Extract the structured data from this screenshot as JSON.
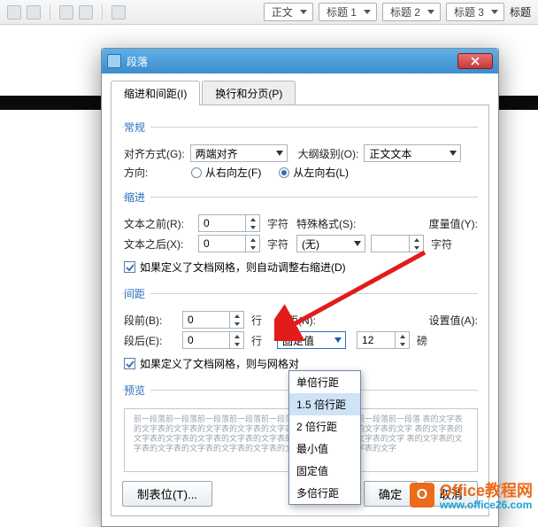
{
  "ribbon": {
    "style_main": "正文",
    "style_presets": [
      "标题 1",
      "标题 2",
      "标题 3",
      "标题"
    ]
  },
  "dialog": {
    "title": "段落",
    "tabs": {
      "indent": "缩进和间距(I)",
      "page": "换行和分页(P)"
    },
    "general": {
      "legend": "常规",
      "align_label": "对齐方式(G):",
      "align_value": "两端对齐",
      "outline_label": "大纲级别(O):",
      "outline_value": "正文文本",
      "direction_label": "方向:",
      "rtl_label": "从右向左(F)",
      "ltr_label": "从左向右(L)"
    },
    "indent": {
      "legend": "缩进",
      "before_label": "文本之前(R):",
      "before_value": "0",
      "after_label": "文本之后(X):",
      "after_value": "0",
      "unit_char": "字符",
      "special_label": "特殊格式(S):",
      "special_value": "(无)",
      "measure_label": "度量值(Y):",
      "measure_value": "",
      "grid_cb": "如果定义了文档网格，则自动调整右缩进(D)"
    },
    "spacing": {
      "legend": "间距",
      "before_label": "段前(B):",
      "before_value": "0",
      "after_label": "段后(E):",
      "after_value": "0",
      "unit_line": "行",
      "linespacing_label": "行距(N):",
      "linespacing_value": "固定值",
      "at_label": "设置值(A):",
      "at_value": "12",
      "at_unit": "磅",
      "grid_cb": "如果定义了文档网格，则与网格对",
      "options": [
        "单倍行距",
        "1.5 倍行距",
        "2 倍行距",
        "最小值",
        "固定值",
        "多倍行距"
      ]
    },
    "preview": {
      "legend": "预览",
      "filler": "前一段落前一段落前一段落前一段落前一段落前一段落前一段落前一段落前一段落 表的文字表的文字表的文字表的文字表的文字表的文字表的文字表的文字表的文字表的文字 表的文字表的文字表的文字表的文字表的文字表的文字表的文字表的文字表的文字表的文字 表的文字表的文字表的文字表的文字表的文字表的文字表的文字表的文字表的文字表的文字"
    },
    "buttons": {
      "tabs": "制表位(T)...",
      "ok": "确定",
      "cancel": "取消"
    }
  },
  "watermark": {
    "brand": "Office教程网",
    "url": "www.office26.com"
  }
}
